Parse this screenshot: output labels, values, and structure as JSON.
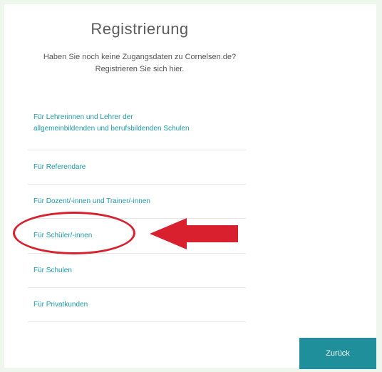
{
  "header": {
    "title": "Registrierung",
    "subtitle_line1": "Haben Sie noch keine Zugangsdaten zu Cornelsen.de?",
    "subtitle_line2": "Registrieren Sie sich hier."
  },
  "registration_options": {
    "items": [
      {
        "label_line1": "Für Lehrerinnen und Lehrer der",
        "label_line2": "allgemeinbildenden und berufsbildenden Schulen"
      },
      {
        "label": "Für Referendare"
      },
      {
        "label": "Für Dozent/-innen und Trainer/-innen"
      },
      {
        "label": "Für Schüler/-innen"
      },
      {
        "label": "Für Schulen"
      },
      {
        "label": "Für Privatkunden"
      }
    ]
  },
  "annotation": {
    "highlight_color": "#d8202f",
    "arrow_icon": "left-arrow-icon"
  },
  "footer": {
    "back_label": "Zurück"
  },
  "colors": {
    "link": "#1f9aa7",
    "button": "#1e8f9b",
    "background": "#eef6ee"
  }
}
